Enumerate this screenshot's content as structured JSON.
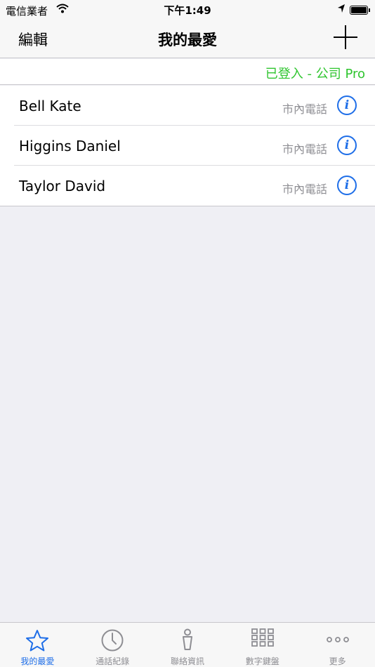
{
  "status_bar": {
    "carrier": "電信業者",
    "time": "下午1:49"
  },
  "nav": {
    "edit_label": "編輯",
    "title": "我的最愛"
  },
  "login_status": "已登入 - 公司 Pro",
  "favorites": [
    {
      "name": "Bell Kate",
      "phone_type": "市內電話"
    },
    {
      "name": "Higgins Daniel",
      "phone_type": "市內電話"
    },
    {
      "name": "Taylor David",
      "phone_type": "市內電話"
    }
  ],
  "tabs": [
    {
      "label": "我的最愛",
      "icon": "star-icon",
      "active": true
    },
    {
      "label": "通話紀錄",
      "icon": "clock-icon",
      "active": false
    },
    {
      "label": "聯絡資訊",
      "icon": "person-icon",
      "active": false
    },
    {
      "label": "數字鍵盤",
      "icon": "keypad-icon",
      "active": false
    },
    {
      "label": "更多",
      "icon": "more-icon",
      "active": false
    }
  ],
  "colors": {
    "accent": "#1e6ee8",
    "login_green": "#2fc52f",
    "inactive_gray": "#8e8e93"
  }
}
